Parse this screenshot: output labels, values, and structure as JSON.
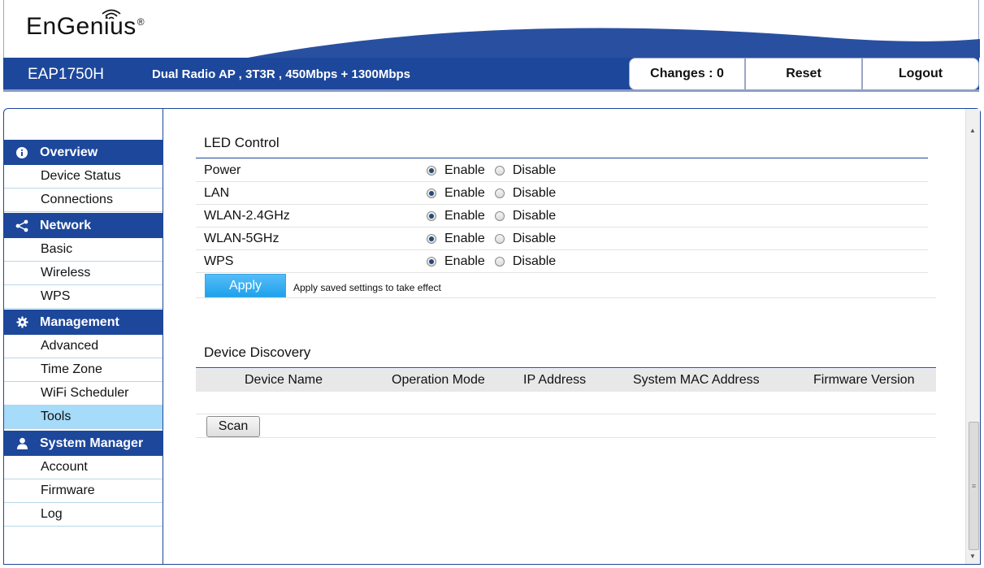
{
  "header": {
    "logo_text": "EnGenius",
    "logo_mark": "®",
    "model": "EAP1750H",
    "description": "Dual Radio AP , 3T3R , 450Mbps + 1300Mbps",
    "changes_label": "Changes : 0",
    "reset_label": "Reset",
    "logout_label": "Logout"
  },
  "sidebar": {
    "sections": [
      {
        "label": "Overview",
        "icon": "info-icon",
        "items": [
          "Device Status",
          "Connections"
        ]
      },
      {
        "label": "Network",
        "icon": "share-icon",
        "items": [
          "Basic",
          "Wireless",
          "WPS"
        ]
      },
      {
        "label": "Management",
        "icon": "gear-icon",
        "items": [
          "Advanced",
          "Time Zone",
          "WiFi Scheduler",
          "Tools"
        ]
      },
      {
        "label": "System Manager",
        "icon": "user-icon",
        "items": [
          "Account",
          "Firmware",
          "Log"
        ]
      }
    ],
    "active_item": "Tools"
  },
  "led_control": {
    "title": "LED Control",
    "enable_label": "Enable",
    "disable_label": "Disable",
    "rows": [
      {
        "label": "Power",
        "value": "Enable"
      },
      {
        "label": "LAN",
        "value": "Enable"
      },
      {
        "label": "WLAN-2.4GHz",
        "value": "Enable"
      },
      {
        "label": "WLAN-5GHz",
        "value": "Enable"
      },
      {
        "label": "WPS",
        "value": "Enable"
      }
    ],
    "apply_label": "Apply",
    "apply_note": "Apply saved settings to take effect"
  },
  "device_discovery": {
    "title": "Device Discovery",
    "columns": [
      "Device Name",
      "Operation Mode",
      "IP Address",
      "System MAC Address",
      "Firmware Version"
    ],
    "scan_label": "Scan"
  },
  "colors": {
    "brand_blue": "#1d479b",
    "active_item": "#a6dbf9",
    "apply_blue": "#1ea2ec"
  }
}
